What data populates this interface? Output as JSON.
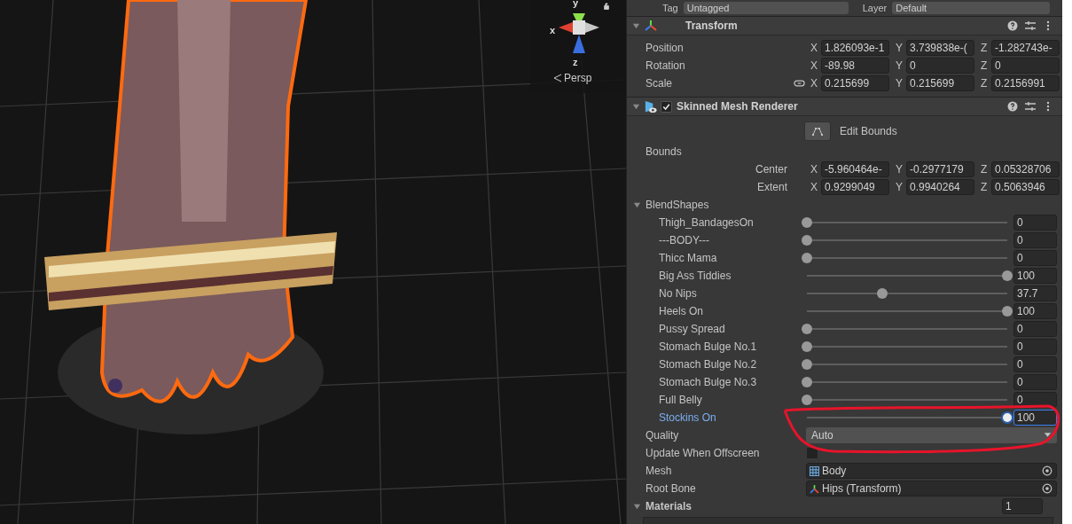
{
  "scene_view": {
    "gizmo_axes": {
      "y": "y",
      "x": "x",
      "z": "z"
    },
    "projection": "Persp"
  },
  "header_row": {
    "tag_label": "Tag",
    "tag_value": "Untagged",
    "layer_label": "Layer",
    "layer_value": "Default"
  },
  "transform": {
    "title": "Transform",
    "expanded": true,
    "rows": [
      {
        "label": "Position",
        "linked": false,
        "values": [
          {
            "axis": "X",
            "value": "1.826093e-1"
          },
          {
            "axis": "Y",
            "value": "3.739838e-("
          },
          {
            "axis": "Z",
            "value": "-1.282743e-"
          }
        ]
      },
      {
        "label": "Rotation",
        "linked": false,
        "values": [
          {
            "axis": "X",
            "value": "-89.98"
          },
          {
            "axis": "Y",
            "value": "0"
          },
          {
            "axis": "Z",
            "value": "0"
          }
        ]
      },
      {
        "label": "Scale",
        "linked": true,
        "values": [
          {
            "axis": "X",
            "value": "0.215699"
          },
          {
            "axis": "Y",
            "value": "0.215699"
          },
          {
            "axis": "Z",
            "value": "0.2156991"
          }
        ]
      }
    ]
  },
  "renderer": {
    "title": "Skinned Mesh Renderer",
    "expanded": true,
    "enabled": true,
    "edit_bounds": "Edit Bounds",
    "bounds_label": "Bounds",
    "bounds": [
      {
        "label": "Center",
        "values": [
          {
            "axis": "X",
            "value": "-5.960464e-"
          },
          {
            "axis": "Y",
            "value": "-0.2977179"
          },
          {
            "axis": "Z",
            "value": "0.05328706"
          }
        ]
      },
      {
        "label": "Extent",
        "values": [
          {
            "axis": "X",
            "value": "0.9299049"
          },
          {
            "axis": "Y",
            "value": "0.9940264"
          },
          {
            "axis": "Z",
            "value": "0.5063946"
          }
        ]
      }
    ],
    "blendshapes_label": "BlendShapes",
    "blendshapes_expanded": true,
    "blendshapes": [
      {
        "name": "Thigh_BandagesOn",
        "level": 0,
        "value": "0",
        "selected": false
      },
      {
        "name": "---BODY---",
        "level": 0,
        "value": "0",
        "selected": false
      },
      {
        "name": "Thicc Mama",
        "level": 0,
        "value": "0",
        "selected": false
      },
      {
        "name": "Big Ass Tiddies",
        "level": 1,
        "value": "100",
        "selected": false
      },
      {
        "name": "No Nips",
        "level": 0.377,
        "value": "37.7",
        "selected": false
      },
      {
        "name": "Heels On",
        "level": 1,
        "value": "100",
        "selected": false
      },
      {
        "name": "Pussy Spread",
        "level": 0,
        "value": "0",
        "selected": false
      },
      {
        "name": "Stomach Bulge No.1",
        "level": 0,
        "value": "0",
        "selected": false
      },
      {
        "name": "Stomach Bulge No.2",
        "level": 0,
        "value": "0",
        "selected": false
      },
      {
        "name": "Stomach Bulge No.3",
        "level": 0,
        "value": "0",
        "selected": false
      },
      {
        "name": "Full Belly",
        "level": 0,
        "value": "0",
        "selected": false
      },
      {
        "name": "Stockins On",
        "level": 1,
        "value": "100",
        "selected": true
      }
    ],
    "quality": {
      "label": "Quality",
      "value": "Auto"
    },
    "update_offscreen": {
      "label": "Update When Offscreen",
      "checked": false
    },
    "mesh": {
      "label": "Mesh",
      "value": "Body"
    },
    "root_bone": {
      "label": "Root Bone",
      "value": "Hips (Transform)"
    }
  },
  "materials": {
    "label": "Materials",
    "expanded": true,
    "count": "1"
  }
}
